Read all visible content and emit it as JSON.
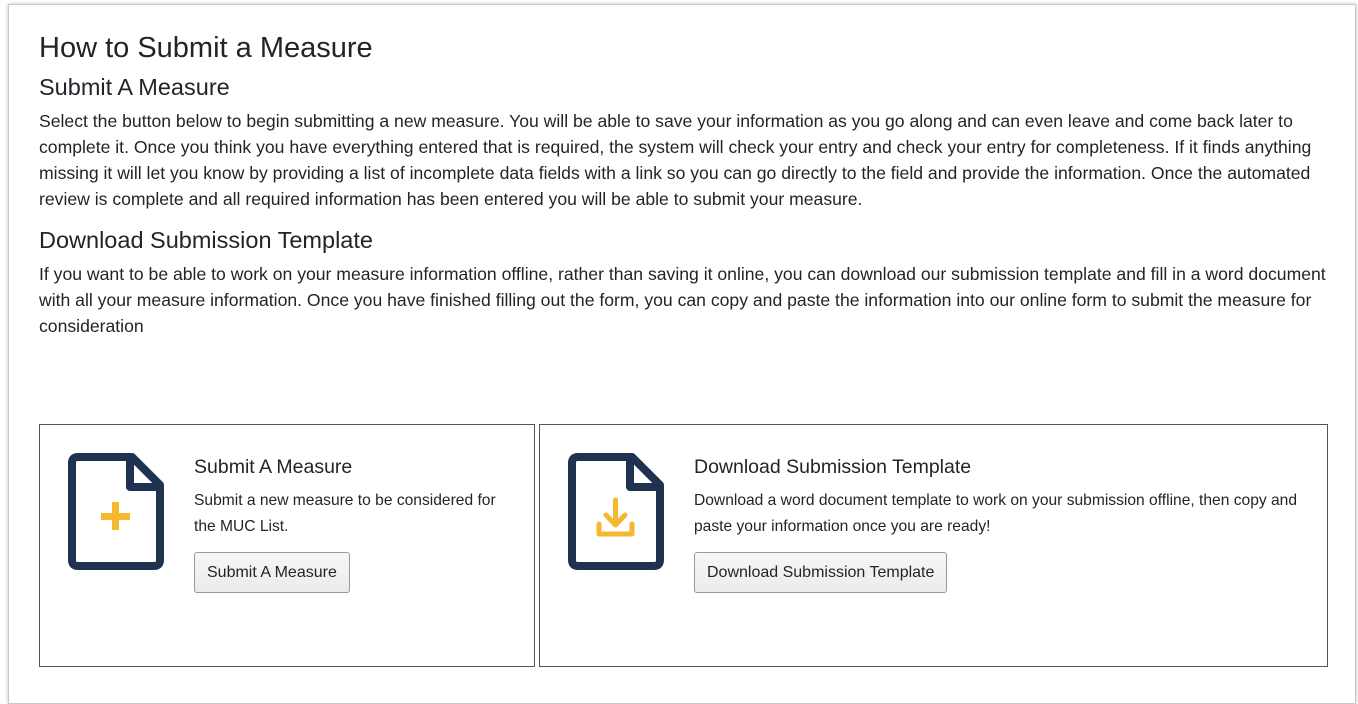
{
  "page": {
    "title": "How to Submit a Measure"
  },
  "sections": {
    "submit": {
      "heading": "Submit A Measure",
      "paragraph": "Select the button below to begin submitting a new measure. You will be able to save your information as you go along and can even leave and come back later to complete it. Once you think you have everything entered that is required, the system will check your entry and check your entry for completeness. If it finds anything missing it will let you know by providing a list of incomplete data fields with a link so you can go directly to the field and provide the information. Once the automated review is complete and all required information has been entered you will be able to submit your measure."
    },
    "download": {
      "heading": "Download Submission Template",
      "paragraph": "If you want to be able to work on your measure information offline, rather than saving it online, you can download our submission template and fill in a word document with all your measure information. Once you have finished filling out the form, you can copy and paste the information into our online form to submit the measure for consideration"
    }
  },
  "cards": {
    "submit": {
      "icon": "document-plus-icon",
      "title": "Submit A Measure",
      "description": "Submit a new measure to be considered for the MUC List.",
      "button_label": "Submit A Measure"
    },
    "download": {
      "icon": "document-download-icon",
      "title": "Download Submission Template",
      "description": "Download a word document template to work on your submission offline, then copy and paste your information once you are ready!",
      "button_label": "Download Submission Template"
    }
  },
  "colors": {
    "icon_outline": "#1f3250",
    "icon_accent": "#f5b82e",
    "text": "#212529",
    "card_border": "#555555"
  }
}
